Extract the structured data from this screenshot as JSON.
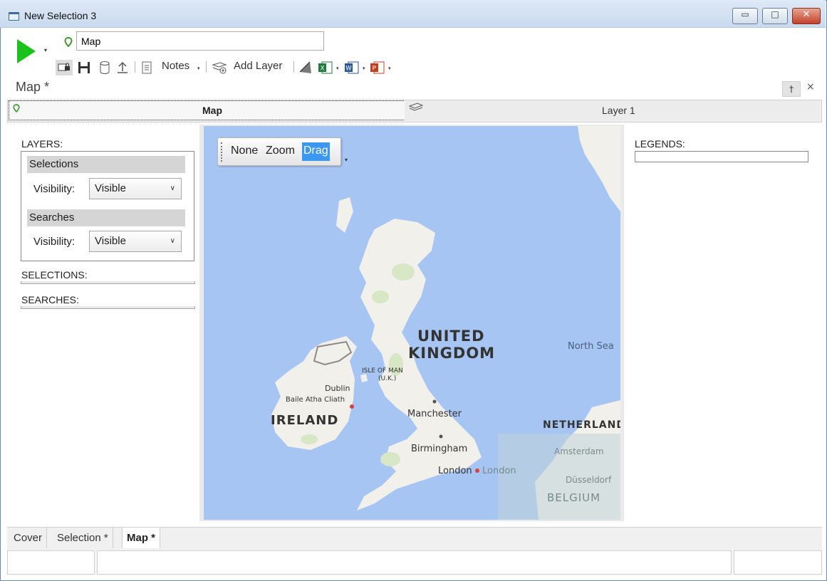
{
  "window": {
    "title": "New Selection 3",
    "controls": {
      "minimize": "▭",
      "maximize": "□",
      "close": "✕"
    }
  },
  "toolbar": {
    "name_value": "Map",
    "notes_label": "Notes",
    "add_layer_label": "Add Layer",
    "dropdown_glyph": "▾"
  },
  "document": {
    "title": "Map *"
  },
  "tabs": [
    {
      "label": "Map",
      "active": true
    },
    {
      "label": "Layer 1",
      "active": false
    }
  ],
  "left_panel": {
    "layers_label": "LAYERS:",
    "groups": [
      {
        "header": "Selections",
        "visibility_label": "Visibility:",
        "visibility_value": "Visible"
      },
      {
        "header": "Searches",
        "visibility_label": "Visibility:",
        "visibility_value": "Visible"
      }
    ],
    "selections_label": "SELECTIONS:",
    "searches_label": "SEARCHES:"
  },
  "map": {
    "modes": [
      {
        "label": "None",
        "active": false
      },
      {
        "label": "Zoom",
        "active": false
      },
      {
        "label": "Drag",
        "active": true
      }
    ],
    "labels": {
      "united": "UNITED",
      "kingdom": "KINGDOM",
      "north_sea": "North Sea",
      "isle_of_man": "ISLE OF MAN",
      "isle_of_man_uk": "(U.K.)",
      "dublin": "Dublin",
      "baile_atha_cliath": "Baile Atha Cliath",
      "ireland": "IRELAND",
      "manchester": "Manchester",
      "birmingham": "Birmingham",
      "london": "London",
      "london_ghost": "London",
      "netherlands": "NETHERLAND",
      "amsterdam": "Amsterdam",
      "dusseldorf": "Düsseldorf",
      "belgium": "BELGIUM"
    },
    "colors": {
      "sea": "#a6c5f2",
      "land": "#f2f0ea",
      "forest": "#d7e6c4"
    }
  },
  "right_panel": {
    "legends_label": "LEGENDS:"
  },
  "bottom_tabs": [
    {
      "label": "Cover",
      "active": false
    },
    {
      "label": "Selection *",
      "active": false
    },
    {
      "label": "Map *",
      "active": true
    }
  ]
}
